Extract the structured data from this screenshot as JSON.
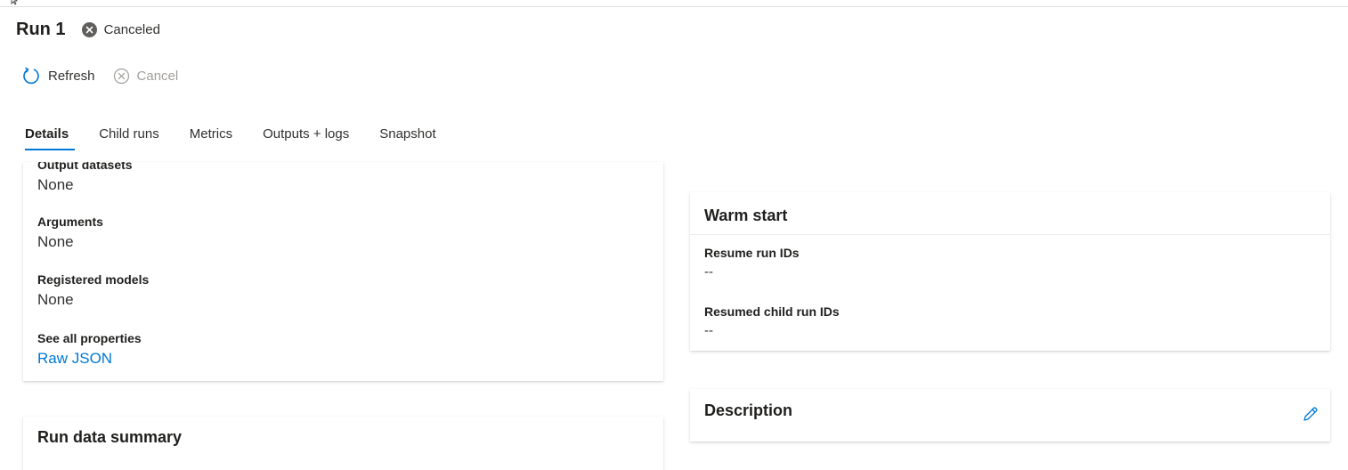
{
  "run": {
    "title": "Run 1",
    "status": "Canceled"
  },
  "toolbar": {
    "refresh_label": "Refresh",
    "cancel_label": "Cancel"
  },
  "tabs": [
    {
      "label": "Details",
      "active": true
    },
    {
      "label": "Child runs",
      "active": false
    },
    {
      "label": "Metrics",
      "active": false
    },
    {
      "label": "Outputs + logs",
      "active": false
    },
    {
      "label": "Snapshot",
      "active": false
    }
  ],
  "details_card": {
    "fields": [
      {
        "label": "Output datasets",
        "value": "None"
      },
      {
        "label": "Arguments",
        "value": "None"
      },
      {
        "label": "Registered models",
        "value": "None"
      },
      {
        "label": "See all properties",
        "link": "Raw JSON"
      }
    ]
  },
  "run_data_summary": {
    "title": "Run data summary"
  },
  "warm_start": {
    "title": "Warm start",
    "fields": [
      {
        "label": "Resume run IDs",
        "value": "--"
      },
      {
        "label": "Resumed child run IDs",
        "value": "--"
      }
    ]
  },
  "description": {
    "title": "Description"
  },
  "colors": {
    "accent": "#0078d4",
    "status_canceled": "#605e5c",
    "disabled": "#a19f9d"
  },
  "icons": {
    "status": "canceled-circle-icon",
    "refresh": "refresh-icon",
    "cancel": "cancel-circle-icon",
    "edit": "pencil-edit-icon"
  }
}
